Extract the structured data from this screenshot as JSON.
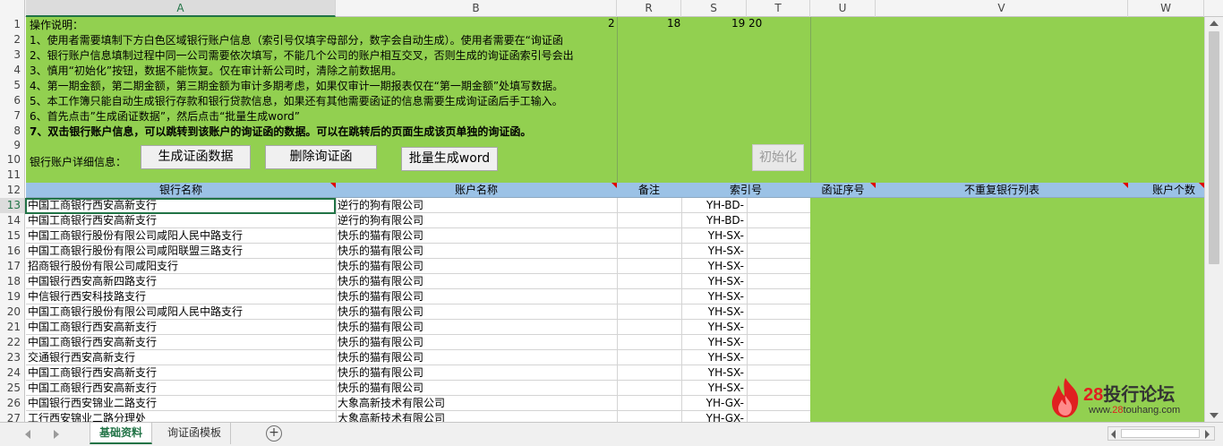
{
  "columns": [
    {
      "key": "A",
      "label": "A"
    },
    {
      "key": "B",
      "label": "B"
    },
    {
      "key": "R",
      "label": "R"
    },
    {
      "key": "S",
      "label": "S"
    },
    {
      "key": "T",
      "label": "T"
    },
    {
      "key": "U",
      "label": "U"
    },
    {
      "key": "V",
      "label": "V"
    },
    {
      "key": "W",
      "label": "W"
    }
  ],
  "rows_nums": [
    "1",
    "2",
    "3",
    "4",
    "5",
    "6",
    "7",
    "8",
    "9",
    "10",
    "11",
    "12",
    "13",
    "14",
    "15",
    "16",
    "17",
    "18",
    "19",
    "20",
    "21",
    "22",
    "23",
    "24",
    "25",
    "26",
    "27"
  ],
  "instructions": [
    "操作说明：",
    "1、使用者需要填制下方白色区域银行账户信息（索引号仅填字母部分，数字会自动生成）。使用者需要在“询证函",
    "2、银行账户信息填制过程中同一公司需要依次填写，不能几个公司的账户相互交叉，否则生成的询证函索引号会出",
    "3、慎用“初始化”按钮，数据不能恢复。仅在审计新公司时，清除之前数据用。",
    "4、第一期金额，第二期金额，第三期金额为审计多期考虑，如果仅审计一期报表仅在“第一期金额”处填写数据。",
    "5、本工作簿只能自动生成银行存款和银行贷款信息，如果还有其他需要函证的信息需要生成询证函后手工输入。",
    "6、首先点击”生成函证数据”，然后点击“批量生成word”",
    "7、双击银行账户信息，可以跳转到该账户的询证函的数据。可以在跳转后的页面生成该页单独的询证函。"
  ],
  "row1_numbers": {
    "b": "2",
    "r": "18",
    "s": "19",
    "t": "20"
  },
  "detail_label": "银行账户详细信息：",
  "buttons": {
    "generate": "生成证函数据",
    "delete": "删除询证函",
    "batch_word": "批量生成word",
    "init": "初始化"
  },
  "table_headers": {
    "bank_name": "银行名称",
    "account_name": "账户名称",
    "note": "备注",
    "index_no": "索引号",
    "letter_no": "函证序号",
    "unique_banks": "不重复银行列表",
    "account_count": "账户个数"
  },
  "table_rows": [
    {
      "row": "13",
      "bank": "中国工商银行西安高新支行",
      "account": "逆行的狗有限公司",
      "index": "YH-BD-"
    },
    {
      "row": "14",
      "bank": "中国工商银行西安高新支行",
      "account": "逆行的狗有限公司",
      "index": "YH-BD-"
    },
    {
      "row": "15",
      "bank": "中国工商银行股份有限公司咸阳人民中路支行",
      "account": "快乐的猫有限公司",
      "index": "YH-SX-"
    },
    {
      "row": "16",
      "bank": "中国工商银行股份有限公司咸阳联盟三路支行",
      "account": "快乐的猫有限公司",
      "index": "YH-SX-"
    },
    {
      "row": "17",
      "bank": "招商银行股份有限公司咸阳支行",
      "account": "快乐的猫有限公司",
      "index": "YH-SX-"
    },
    {
      "row": "18",
      "bank": "中国银行西安高新四路支行",
      "account": "快乐的猫有限公司",
      "index": "YH-SX-"
    },
    {
      "row": "19",
      "bank": "中信银行西安科技路支行",
      "account": "快乐的猫有限公司",
      "index": "YH-SX-"
    },
    {
      "row": "20",
      "bank": "中国工商银行股份有限公司咸阳人民中路支行",
      "account": "快乐的猫有限公司",
      "index": "YH-SX-"
    },
    {
      "row": "21",
      "bank": "中国工商银行西安高新支行",
      "account": "快乐的猫有限公司",
      "index": "YH-SX-"
    },
    {
      "row": "22",
      "bank": "中国工商银行西安高新支行",
      "account": "快乐的猫有限公司",
      "index": "YH-SX-"
    },
    {
      "row": "23",
      "bank": "交通银行西安高新支行",
      "account": "快乐的猫有限公司",
      "index": "YH-SX-"
    },
    {
      "row": "24",
      "bank": "中国工商银行西安高新支行",
      "account": "快乐的猫有限公司",
      "index": "YH-SX-"
    },
    {
      "row": "25",
      "bank": "中国工商银行西安高新支行",
      "account": "快乐的猫有限公司",
      "index": "YH-SX-"
    },
    {
      "row": "26",
      "bank": "中国银行西安锦业二路支行",
      "account": "大象高新技术有限公司",
      "index": "YH-GX-"
    },
    {
      "row": "27",
      "bank": "工行西安锦业二路分理处",
      "account": "大象高新技术有限公司",
      "index": "YH-GX-"
    }
  ],
  "sheet_tabs": [
    {
      "label": "基础资料",
      "active": true
    },
    {
      "label": "询证函模板",
      "active": false
    }
  ],
  "add_sheet_symbol": "+",
  "watermark": {
    "number": "28",
    "title": "投行论坛",
    "url_prefix": "www.",
    "url_red": "28",
    "url_suffix": "touhang.com"
  },
  "colors": {
    "green_fill": "#92d050",
    "header_blue": "#9bc2e6",
    "excel_green": "#217346",
    "comment_red": "#e00000"
  }
}
